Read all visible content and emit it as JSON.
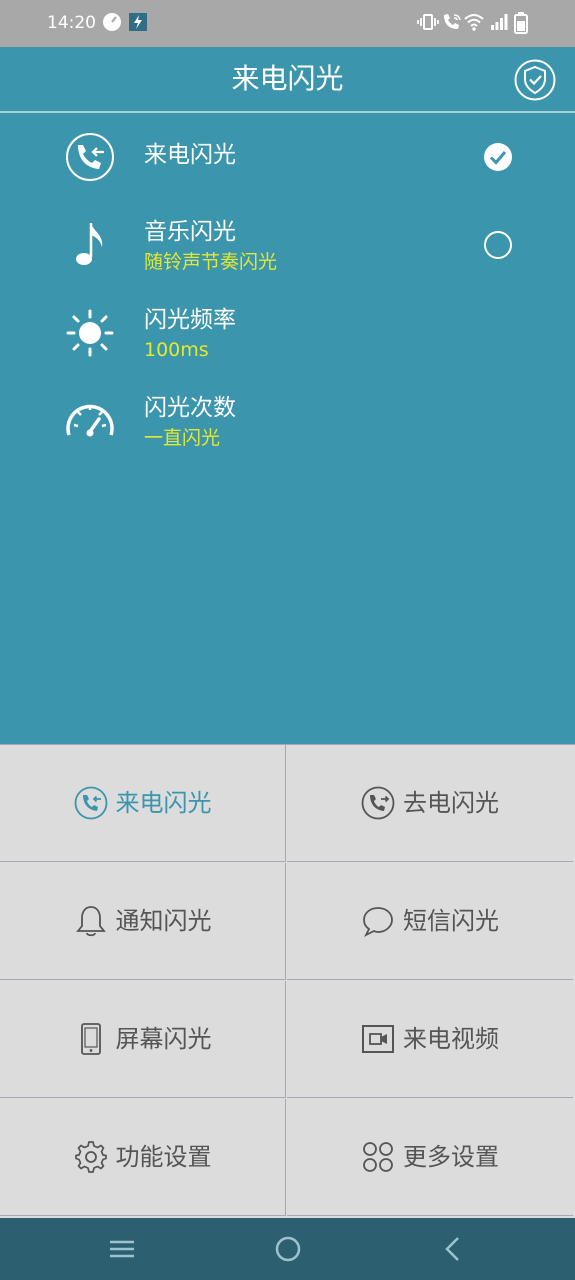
{
  "status_bar": {
    "time": "14:20",
    "icons": [
      "speed-icon",
      "flash-notify-icon",
      "vibrate-icon",
      "wifi-call-icon",
      "wifi-icon",
      "signal-icon",
      "battery-icon"
    ]
  },
  "header": {
    "title": "来电闪光",
    "right_icon": "shield-check-icon"
  },
  "settings": [
    {
      "label": "来电闪光",
      "sub": "",
      "icon": "incoming-call-icon",
      "control": "checked"
    },
    {
      "label": "音乐闪光",
      "sub": "随铃声节奏闪光",
      "icon": "music-note-icon",
      "control": "unchecked"
    },
    {
      "label": "闪光频率",
      "sub": "100ms",
      "icon": "sun-icon",
      "control": "none"
    },
    {
      "label": "闪光次数",
      "sub": "一直闪光",
      "icon": "speedometer-icon",
      "control": "none"
    }
  ],
  "grid": [
    {
      "label": "来电闪光",
      "icon": "incoming-call-icon",
      "active": true
    },
    {
      "label": "去电闪光",
      "icon": "outgoing-call-icon",
      "active": false
    },
    {
      "label": "通知闪光",
      "icon": "bell-icon",
      "active": false
    },
    {
      "label": "短信闪光",
      "icon": "chat-bubble-icon",
      "active": false
    },
    {
      "label": "屏幕闪光",
      "icon": "phone-screen-icon",
      "active": false
    },
    {
      "label": "来电视频",
      "icon": "video-call-icon",
      "active": false
    },
    {
      "label": "功能设置",
      "icon": "gear-icon",
      "active": false
    },
    {
      "label": "更多设置",
      "icon": "more-circles-icon",
      "active": false
    }
  ],
  "colors": {
    "primary": "#3b95ac",
    "accent_text": "#e4e830",
    "grid_bg": "#dcdcdc",
    "nav_bg": "#2c6070"
  },
  "nav_bar": {
    "icons": [
      "menu-icon",
      "home-icon",
      "back-icon"
    ]
  }
}
